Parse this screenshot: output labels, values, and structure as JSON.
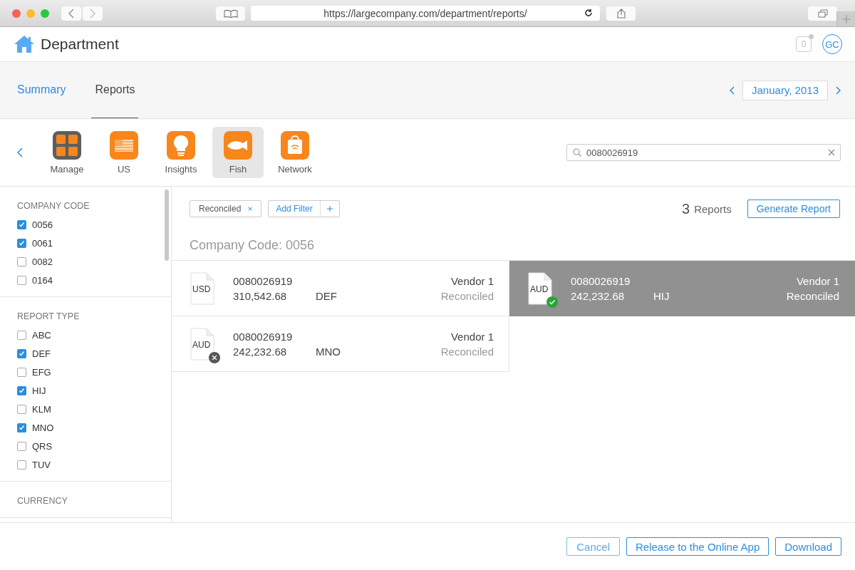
{
  "browser": {
    "url": "https://largecompany.com/department/reports/"
  },
  "header": {
    "title": "Department",
    "notifications": "0",
    "avatar": "GC"
  },
  "nav": {
    "tabs": [
      {
        "label": "Summary",
        "selected": false
      },
      {
        "label": "Reports",
        "selected": true
      }
    ],
    "date": "January, 2013"
  },
  "apps": [
    {
      "label": "Manage",
      "kind": "grid",
      "selected": false
    },
    {
      "label": "US",
      "kind": "flag",
      "selected": false
    },
    {
      "label": "Insights",
      "kind": "bulb",
      "selected": false
    },
    {
      "label": "Fish",
      "kind": "fish",
      "selected": true
    },
    {
      "label": "Network",
      "kind": "bag",
      "selected": false
    }
  ],
  "search": {
    "value": "0080026919"
  },
  "sidebar": [
    {
      "title": "COMPANY CODE",
      "items": [
        {
          "label": "0056",
          "checked": true
        },
        {
          "label": "0061",
          "checked": true
        },
        {
          "label": "0082",
          "checked": false
        },
        {
          "label": "0164",
          "checked": false
        }
      ]
    },
    {
      "title": "REPORT TYPE",
      "items": [
        {
          "label": "ABC",
          "checked": false
        },
        {
          "label": "DEF",
          "checked": true
        },
        {
          "label": "EFG",
          "checked": false
        },
        {
          "label": "HIJ",
          "checked": true
        },
        {
          "label": "KLM",
          "checked": false
        },
        {
          "label": "MNO",
          "checked": true
        },
        {
          "label": "QRS",
          "checked": false
        },
        {
          "label": "TUV",
          "checked": false
        }
      ]
    },
    {
      "title": "CURRENCY"
    }
  ],
  "filters": {
    "chip": "Reconciled",
    "add": "Add Filter"
  },
  "count": {
    "number": "3",
    "label": "Reports"
  },
  "generate": "Generate Report",
  "group_title": "Company Code: 0056",
  "reports": [
    {
      "file": "USD",
      "kind": "plain",
      "number": "0080026919",
      "amount": "310,542.68",
      "type": "DEF",
      "vendor": "Vendor 1",
      "status": "Reconciled",
      "selected": false
    },
    {
      "file": "AUD",
      "kind": "approved",
      "number": "0080026919",
      "amount": "242,232.68",
      "type": "HIJ",
      "vendor": "Vendor 1",
      "status": "Reconciled",
      "selected": true
    },
    {
      "file": "AUD",
      "kind": "rejected",
      "number": "0080026919",
      "amount": "242,232.68",
      "type": "MNO",
      "vendor": "Vendor 1",
      "status": "Reconciled",
      "selected": false
    }
  ],
  "footer": {
    "buttons": [
      "Cancel",
      "Release to the Online App",
      "Download"
    ]
  }
}
